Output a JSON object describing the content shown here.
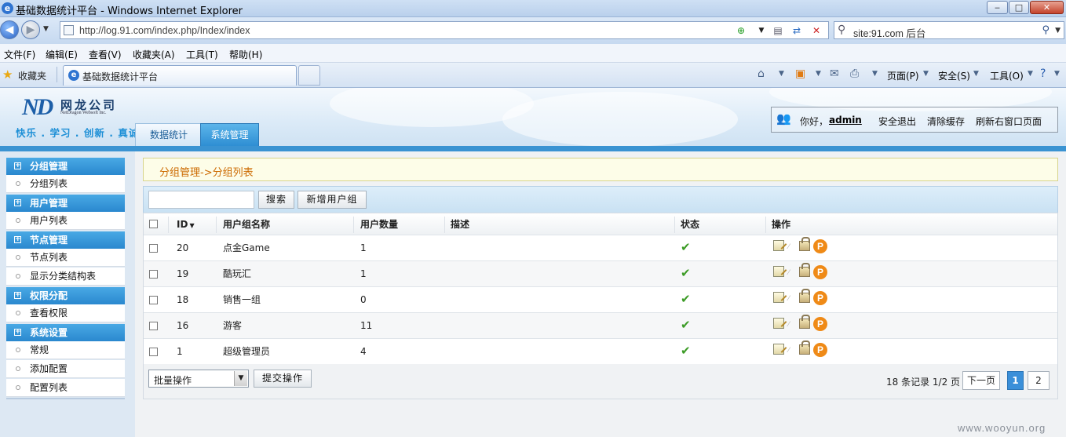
{
  "browser": {
    "window_title": "基础数据统计平台 - Windows Internet Explorer",
    "url": "http://log.91.com/index.php/Index/index",
    "search_text": "site:91.com 后台",
    "menu": [
      "文件(F)",
      "编辑(E)",
      "查看(V)",
      "收藏夹(A)",
      "工具(T)",
      "帮助(H)"
    ],
    "favorites_label": "收藏夹",
    "tab_title": "基础数据统计平台",
    "commands": [
      "页面(P)",
      "安全(S)",
      "工具(O)"
    ]
  },
  "header": {
    "company": "网龙公司",
    "company_en": "NetDragon Websoft Inc.",
    "slogan": "快乐 . 学习 . 创新 . 真诚",
    "tabs": [
      {
        "label": "数据统计",
        "active": false
      },
      {
        "label": "系统管理",
        "active": true
      }
    ],
    "greeting": "你好，",
    "username": "admin",
    "links": [
      "安全退出",
      "清除缓存",
      "刷新右窗口页面"
    ]
  },
  "sidebar": {
    "groups": [
      {
        "title": "分组管理",
        "items": [
          "分组列表"
        ]
      },
      {
        "title": "用户管理",
        "items": [
          "用户列表"
        ]
      },
      {
        "title": "节点管理",
        "items": [
          "节点列表",
          "显示分类结构表"
        ]
      },
      {
        "title": "权限分配",
        "items": [
          "查看权限"
        ]
      },
      {
        "title": "系统设置",
        "items": [
          "常规",
          "添加配置",
          "配置列表"
        ]
      }
    ]
  },
  "main": {
    "breadcrumb": "分组管理->分组列表",
    "search_button": "搜索",
    "add_button": "新增用户组",
    "columns": {
      "id": "ID",
      "name": "用户组名称",
      "count": "用户数量",
      "desc": "描述",
      "status": "状态",
      "op": "操作"
    },
    "rows": [
      {
        "id": "20",
        "name": "点金Game",
        "count": "1",
        "desc": "",
        "status": "enabled"
      },
      {
        "id": "19",
        "name": "酷玩汇",
        "count": "1",
        "desc": "",
        "status": "enabled"
      },
      {
        "id": "18",
        "name": "销售一组",
        "count": "0",
        "desc": "",
        "status": "enabled"
      },
      {
        "id": "16",
        "name": "游客",
        "count": "11",
        "desc": "",
        "status": "enabled"
      },
      {
        "id": "1",
        "name": "超级管理员",
        "count": "4",
        "desc": "",
        "status": "enabled"
      }
    ],
    "batch_select": "批量操作",
    "submit_button": "提交操作",
    "pager": {
      "info": "18 条记录 1/2 页",
      "next": "下一页",
      "pages": [
        "1",
        "2"
      ],
      "current": "1"
    }
  },
  "watermark": "www.wooyun.org",
  "colors": {
    "accent": "#2e8ed3",
    "breadcrumb": "#cc6a00",
    "ok": "#3b9b25",
    "op_p": "#ef8a17"
  }
}
